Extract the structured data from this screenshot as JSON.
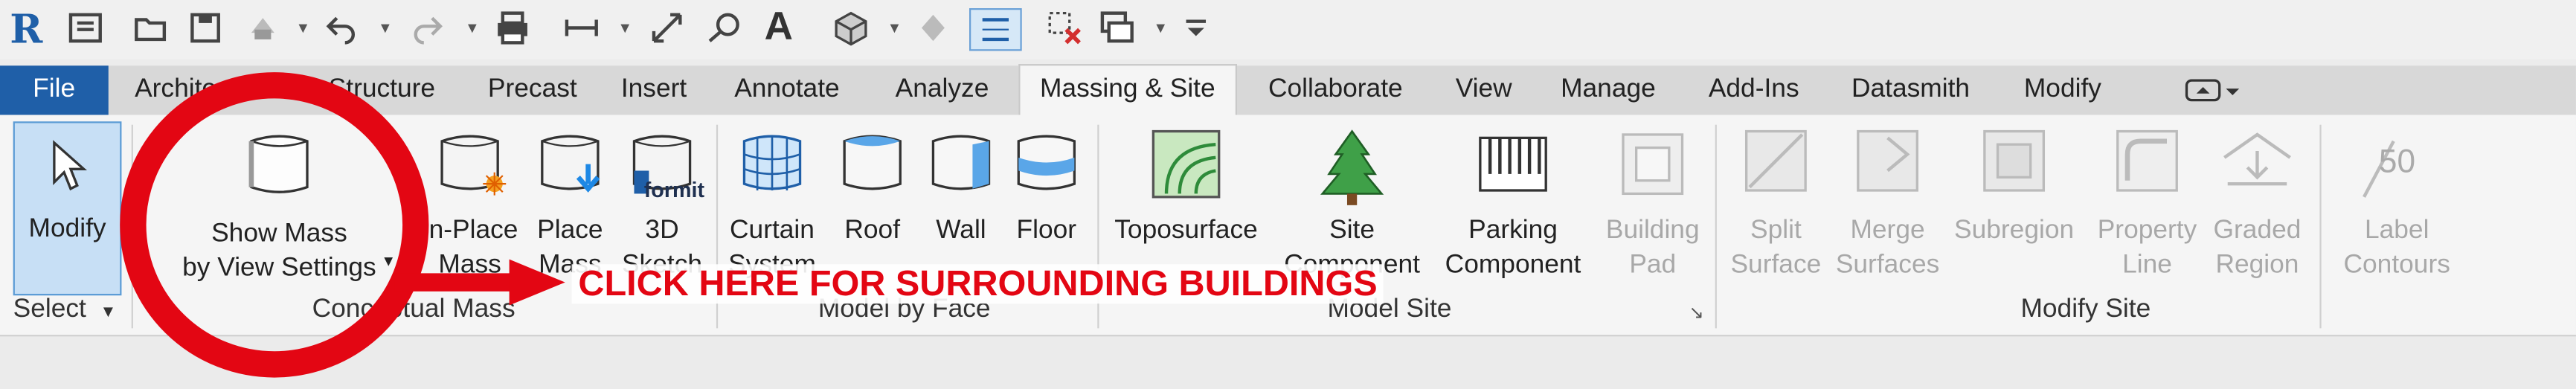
{
  "quick_access": {
    "logo": "R",
    "icons": [
      "revit-logo-icon",
      "open-icon",
      "save-icon",
      "sync-icon",
      "undo-icon",
      "redo-icon",
      "print-icon",
      "measure-icon",
      "dimension-icon",
      "tag-icon",
      "text-icon",
      "3d-view-icon",
      "section-icon",
      "thin-lines-icon",
      "close-hidden-icon",
      "switch-windows-icon",
      "customize-icon"
    ]
  },
  "tabs": {
    "file": "File",
    "items": [
      "Architecture",
      "Structure",
      "Precast",
      "Insert",
      "Annotate",
      "Analyze",
      "Massing & Site",
      "Collaborate",
      "View",
      "Manage",
      "Add-Ins",
      "Datasmith",
      "Modify"
    ],
    "active": "Massing & Site"
  },
  "ribbon": {
    "modify": "Modify",
    "select": "Select",
    "conceptual_mass": {
      "label": "Conceptual Mass",
      "show_mass_l1": "Show Mass",
      "show_mass_l2": "by View Settings",
      "inplace_l1": "In-Place",
      "inplace_l2": "Mass",
      "place_l1": "Place",
      "place_l2": "Mass",
      "sketch_l1": "3D",
      "sketch_l2": "Sketch",
      "formit": "formit"
    },
    "model_by_face": {
      "label": "Model by Face",
      "curtain_l1": "Curtain",
      "curtain_l2": "System",
      "roof": "Roof",
      "wall": "Wall",
      "floor": "Floor"
    },
    "model_site": {
      "label": "Model Site",
      "toposurface": "Toposurface",
      "site_l1": "Site",
      "site_l2": "Component",
      "parking_l1": "Parking",
      "parking_l2": "Component",
      "building_l1": "Building",
      "building_l2": "Pad"
    },
    "modify_site": {
      "label": "Modify Site",
      "split_l1": "Split",
      "split_l2": "Surface",
      "merge_l1": "Merge",
      "merge_l2": "Surfaces",
      "subregion": "Subregion",
      "property_l1": "Property",
      "property_l2": "Line",
      "graded_l1": "Graded",
      "graded_l2": "Region",
      "label_l1": "Label",
      "label_l2": "Contours",
      "label_icon_text": "50"
    }
  },
  "annotation": {
    "callout": "CLICK HERE FOR SURROUNDING BUILDINGS",
    "color": "#e30613"
  },
  "colors": {
    "file_tab": "#1f5fa8",
    "accent_blue": "#1e88e5",
    "tree_green": "#2e8b3a"
  }
}
